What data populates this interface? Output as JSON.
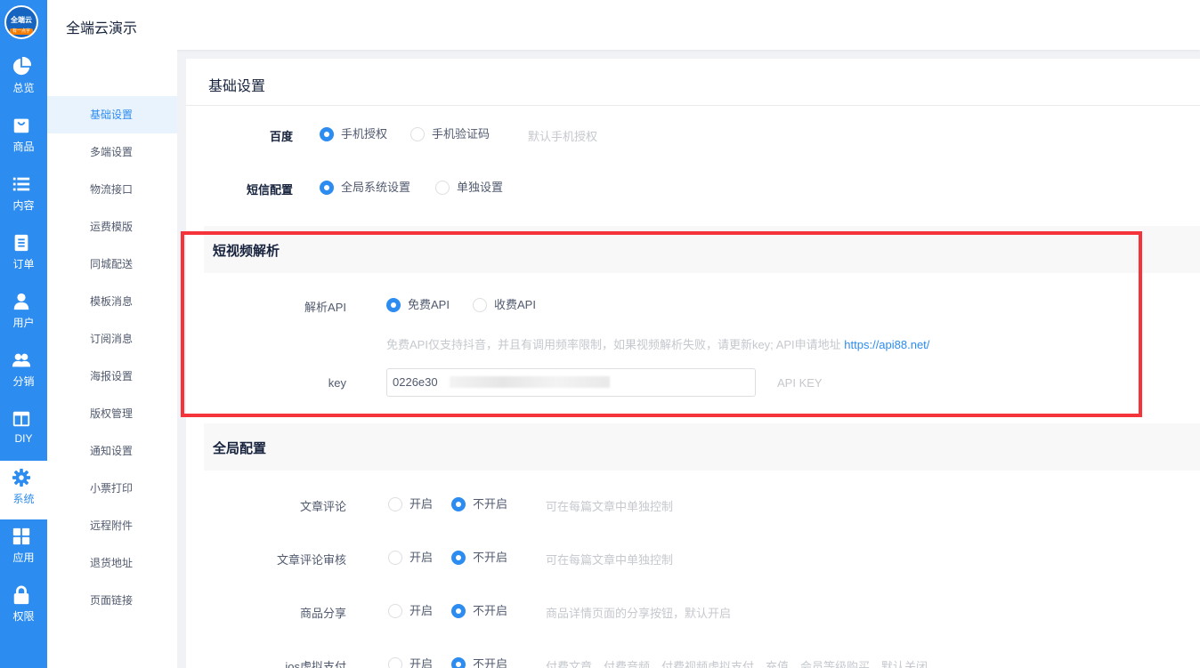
{
  "logo": {
    "top": "全端云",
    "band": "有一点字"
  },
  "rail": [
    {
      "label": "总览",
      "icon": "pie-chart-icon"
    },
    {
      "label": "商品",
      "icon": "shopping-bag-icon"
    },
    {
      "label": "内容",
      "icon": "list-icon"
    },
    {
      "label": "订单",
      "icon": "document-icon"
    },
    {
      "label": "用户",
      "icon": "user-icon"
    },
    {
      "label": "分销",
      "icon": "users-icon"
    },
    {
      "label": "DIY",
      "icon": "layout-icon"
    },
    {
      "label": "系统",
      "icon": "gear-icon",
      "active": true
    },
    {
      "label": "应用",
      "icon": "grid-icon"
    },
    {
      "label": "权限",
      "icon": "lock-icon"
    }
  ],
  "header": {
    "title": "全端云演示"
  },
  "submenu": [
    "基础设置",
    "多端设置",
    "物流接口",
    "运费模版",
    "同城配送",
    "模板消息",
    "订阅消息",
    "海报设置",
    "版权管理",
    "通知设置",
    "小票打印",
    "远程附件",
    "退货地址",
    "页面链接"
  ],
  "card": {
    "title": "基础设置"
  },
  "baidu": {
    "label": "百度",
    "opt1": "手机授权",
    "opt2": "手机验证码",
    "hint": "默认手机授权"
  },
  "sms": {
    "label": "短信配置",
    "opt1": "全局系统设置",
    "opt2": "单独设置"
  },
  "video": {
    "section": "短视频解析",
    "api_label": "解析API",
    "opt1": "免费API",
    "opt2": "收费API",
    "hint": "免费API仅支持抖音，并且有调用频率限制，如果视频解析失败，请更新key; API申请地址",
    "link": "https://api88.net/",
    "key_label": "key",
    "key_value": "0226e30",
    "key_hint": "API KEY"
  },
  "global": {
    "section": "全局配置",
    "rows": [
      {
        "label": "文章评论",
        "on": "开启",
        "off": "不开启",
        "hint": "可在每篇文章中单独控制"
      },
      {
        "label": "文章评论审核",
        "on": "开启",
        "off": "不开启",
        "hint": "可在每篇文章中单独控制"
      },
      {
        "label": "商品分享",
        "on": "开启",
        "off": "不开启",
        "hint": "商品详情页面的分享按钮，默认开启"
      },
      {
        "label": "ios虚拟支付",
        "on": "开启",
        "off": "不开启",
        "hint": "付费文章、付费音频、付费视频虚拟支付、充值、会员等级购买，默认关闭"
      }
    ]
  },
  "colors": {
    "accent": "#2d8cf0",
    "highlight": "#f5333a"
  }
}
